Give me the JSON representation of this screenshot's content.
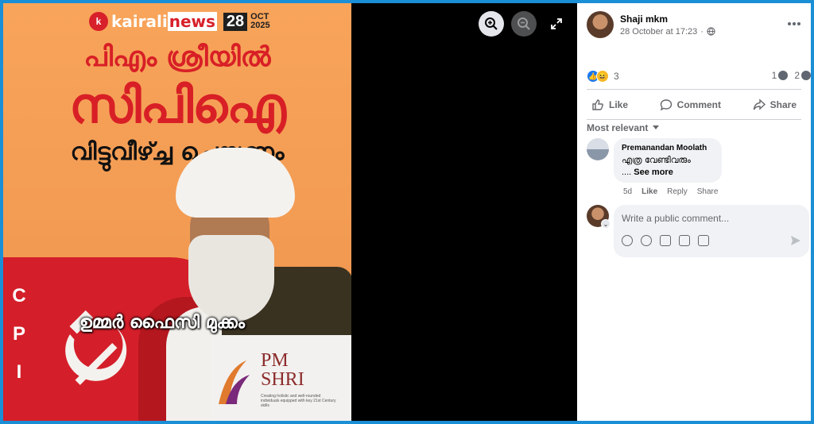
{
  "image": {
    "logo_brand": "kairali",
    "logo_brand_accent": "news",
    "date_day": "28",
    "date_month": "OCT",
    "date_year": "2025",
    "headline_1": "പിഎം ശ്രീയിൽ",
    "headline_2": "സിപിഐ",
    "headline_3": "വിട്ടുവീഴ്ച്ച ചെയ്യണം",
    "name_caption": "ഉമ്മർ ഫൈസി മുക്കം",
    "flag_letters": [
      "C",
      "P",
      "I"
    ],
    "badge_line1": "PM",
    "badge_line2": "SHRI",
    "badge_sub": "Creating holistic and well-rounded individuals equipped with key 21st Century skills"
  },
  "viewer": {
    "zoom_in_icon": "zoom-in-icon",
    "zoom_out_icon": "zoom-out-icon",
    "fullscreen_icon": "fullscreen-icon"
  },
  "post": {
    "author": "Shaji mkm",
    "time": "28 October at 17:23",
    "separator": "·",
    "privacy_icon": "globe-icon",
    "more_icon": "more-horizontal-icon",
    "reaction_count": "3",
    "comment_count": "1",
    "share_count": "2"
  },
  "actions": {
    "like": "Like",
    "comment": "Comment",
    "share": "Share"
  },
  "comments": {
    "sort_label": "Most relevant",
    "items": [
      {
        "author": "Premanandan Moolath",
        "text": "എത്ര വേണ്ടിവരും",
        "ellipsis": "....",
        "see_more": "See more",
        "age": "5d",
        "like": "Like",
        "reply": "Reply",
        "share": "Share"
      }
    ]
  },
  "composer": {
    "placeholder": "Write a public comment..."
  },
  "colors": {
    "accent": "#1877f2",
    "frame": "#1a8fd6",
    "flag_red": "#d41f2a"
  }
}
